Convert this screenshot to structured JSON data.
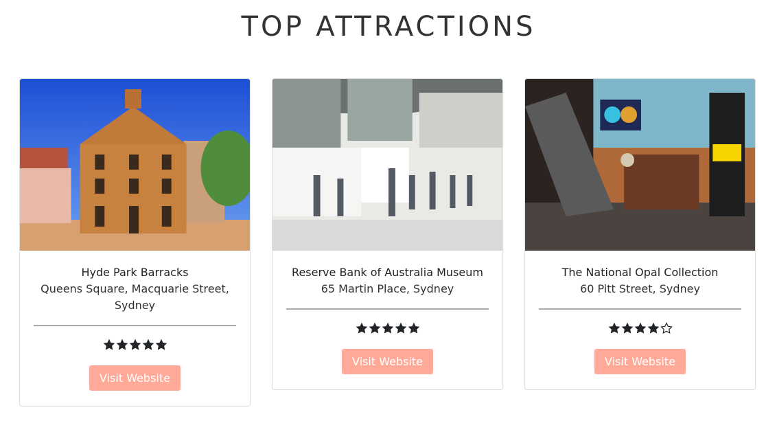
{
  "page": {
    "title": "TOP ATTRACTIONS"
  },
  "cards": [
    {
      "name": "Hyde Park Barracks",
      "address": "Queens Square, Macquarie Street, Sydney",
      "rating": 5,
      "button_label": "Visit Website",
      "image_icon": "hyde-park-barracks-photo"
    },
    {
      "name": "Reserve Bank of Australia Museum",
      "address": "65 Martin Place, Sydney",
      "rating": 5,
      "button_label": "Visit Website",
      "image_icon": "reserve-bank-museum-photo"
    },
    {
      "name": "The National Opal Collection",
      "address": "60 Pitt Street, Sydney",
      "rating": 4,
      "button_label": "Visit Website",
      "image_icon": "opal-collection-photo"
    }
  ],
  "colors": {
    "button_bg": "#ffaa99",
    "star_fill": "#212529",
    "divider": "#a9a9a9"
  }
}
